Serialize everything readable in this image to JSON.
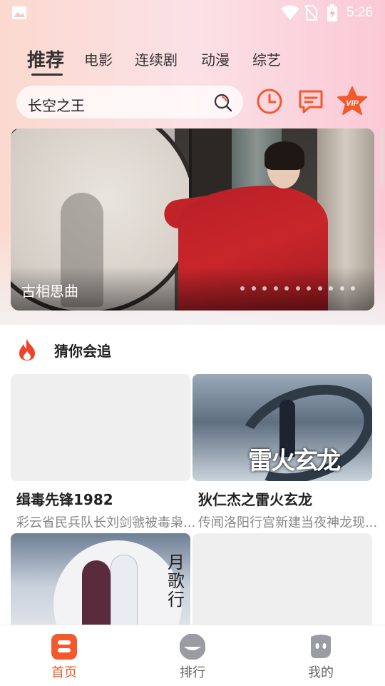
{
  "status_bar": {
    "time": "5:26",
    "icons": [
      "image-icon",
      "wifi-icon",
      "no-sim-icon",
      "battery-charging-icon"
    ]
  },
  "tabs": [
    {
      "label": "推荐",
      "active": true
    },
    {
      "label": "电影"
    },
    {
      "label": "连续剧"
    },
    {
      "label": "动漫"
    },
    {
      "label": "综艺"
    }
  ],
  "search": {
    "value": "长空之王",
    "icon": "search-icon"
  },
  "header_actions": [
    "history-clock-icon",
    "message-icon",
    "vip-star-icon"
  ],
  "vip_badge": "VIP",
  "banner": {
    "caption": "古相思曲",
    "dot_count": 11
  },
  "section": {
    "title": "猜你会追",
    "icon": "fire-icon"
  },
  "cards": [
    {
      "title": "缉毒先锋1982",
      "desc": "彩云省民兵队长刘剑虢被毒枭..."
    },
    {
      "title": "狄仁杰之雷火玄龙",
      "desc": "传闻洛阳行宫新建当夜神龙现..."
    },
    {
      "title": "",
      "desc": ""
    },
    {
      "title": "",
      "desc": ""
    }
  ],
  "poster_text": {
    "card2": "雷火玄龙",
    "card3": "月歌行"
  },
  "bottom_nav": [
    {
      "label": "首页",
      "icon": "home-icon",
      "active": true
    },
    {
      "label": "排行",
      "icon": "ranking-icon"
    },
    {
      "label": "我的",
      "icon": "profile-icon"
    }
  ],
  "colors": {
    "accent": "#f25a2e",
    "header_icon": "#f25a2e",
    "text_primary": "#222222",
    "text_secondary": "#888888"
  }
}
